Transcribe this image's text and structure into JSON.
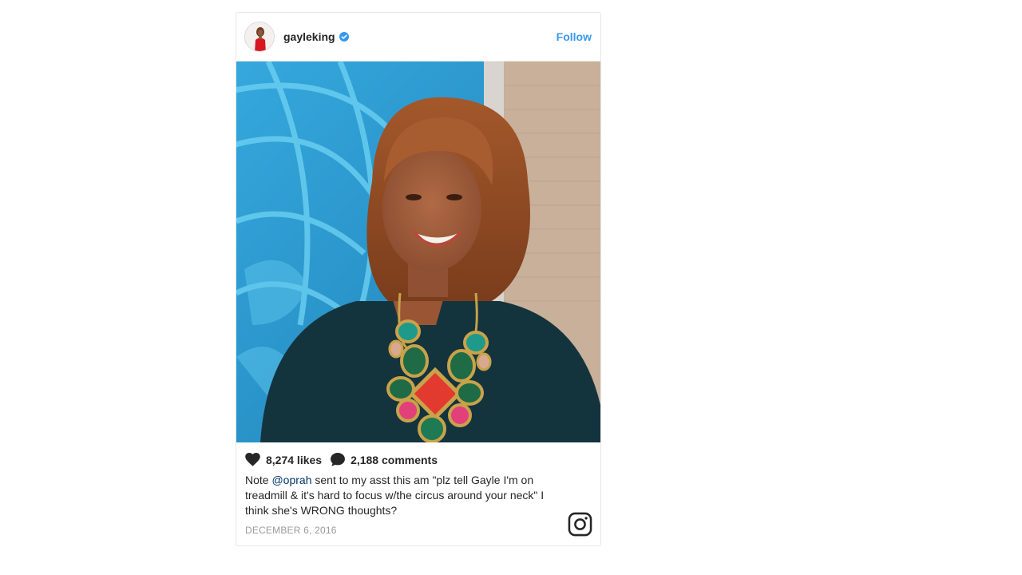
{
  "post": {
    "username": "gayleking",
    "follow_label": "Follow",
    "likes": "8,274 likes",
    "comments": "2,188 comments",
    "caption_prefix": "Note ",
    "caption_mention": "@oprah",
    "caption_rest": " sent to my asst this am \"plz tell Gayle I'm on treadmill & it's hard to focus w/the circus around your neck\" I think she's WRONG thoughts?",
    "date": "DECEMBER 6, 2016"
  },
  "icons": {
    "verified": "verified-badge-icon",
    "like": "heart-icon",
    "comment": "comment-bubble-icon",
    "brand": "instagram-logo-icon"
  },
  "colors": {
    "accent": "#3897f0",
    "mention": "#003569",
    "muted": "#999999"
  }
}
